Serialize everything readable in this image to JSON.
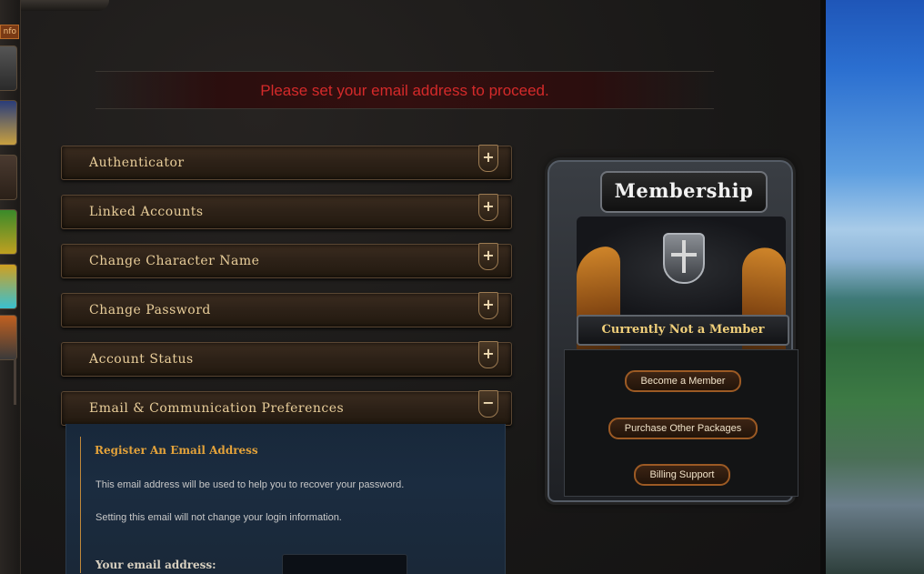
{
  "sidebar": {
    "tab_label": "nfo",
    "icons": [
      "helmet-icon",
      "banner-icon",
      "portrait-icon",
      "potion-icon",
      "add-friend-icon",
      "bomb-icon"
    ]
  },
  "notice": {
    "text": "Please set your email address to proceed.",
    "color": "#d42a2a"
  },
  "sections": [
    {
      "label": "Authenticator",
      "toggle": "+"
    },
    {
      "label": "Linked Accounts",
      "toggle": "+"
    },
    {
      "label": "Change Character Name",
      "toggle": "+"
    },
    {
      "label": "Change Password",
      "toggle": "+"
    },
    {
      "label": "Account Status",
      "toggle": "+"
    },
    {
      "label": "Email & Communication Preferences",
      "toggle": "−"
    }
  ],
  "email_section": {
    "title": "Register An Email Address",
    "info_1": "This email address will be used to help you to recover your password.",
    "info_2": "Setting this email will not change your login information.",
    "email_label": "Your email address:",
    "email_value": ""
  },
  "membership": {
    "title": "Membership",
    "status": "Currently Not a Member",
    "buttons": {
      "become": "Become a Member",
      "packages": "Purchase Other Packages",
      "billing": "Billing Support"
    }
  },
  "colors": {
    "accent_gold": "#e9ce9a",
    "section_title": "#e3a23a",
    "button_border": "#9c5a24"
  }
}
